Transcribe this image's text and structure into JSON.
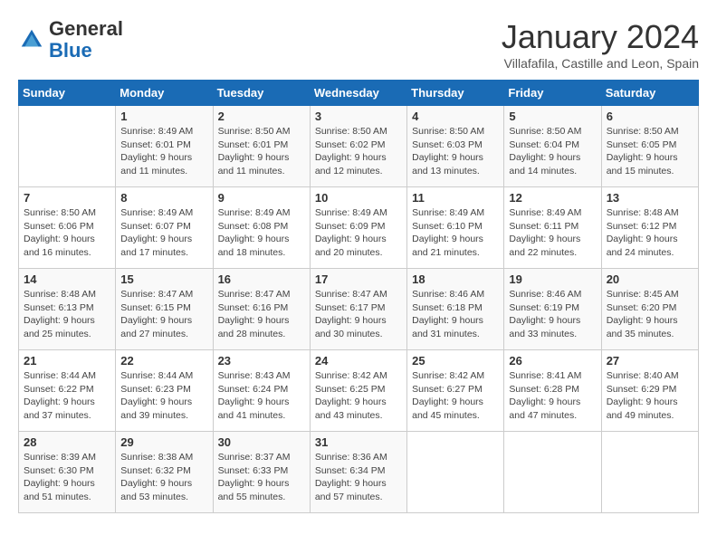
{
  "logo": {
    "general": "General",
    "blue": "Blue"
  },
  "header": {
    "month": "January 2024",
    "location": "Villafafila, Castille and Leon, Spain"
  },
  "weekdays": [
    "Sunday",
    "Monday",
    "Tuesday",
    "Wednesday",
    "Thursday",
    "Friday",
    "Saturday"
  ],
  "rows": [
    [
      {
        "day": "",
        "sunrise": "",
        "sunset": "",
        "daylight": ""
      },
      {
        "day": "1",
        "sunrise": "Sunrise: 8:49 AM",
        "sunset": "Sunset: 6:01 PM",
        "daylight": "Daylight: 9 hours and 11 minutes."
      },
      {
        "day": "2",
        "sunrise": "Sunrise: 8:50 AM",
        "sunset": "Sunset: 6:01 PM",
        "daylight": "Daylight: 9 hours and 11 minutes."
      },
      {
        "day": "3",
        "sunrise": "Sunrise: 8:50 AM",
        "sunset": "Sunset: 6:02 PM",
        "daylight": "Daylight: 9 hours and 12 minutes."
      },
      {
        "day": "4",
        "sunrise": "Sunrise: 8:50 AM",
        "sunset": "Sunset: 6:03 PM",
        "daylight": "Daylight: 9 hours and 13 minutes."
      },
      {
        "day": "5",
        "sunrise": "Sunrise: 8:50 AM",
        "sunset": "Sunset: 6:04 PM",
        "daylight": "Daylight: 9 hours and 14 minutes."
      },
      {
        "day": "6",
        "sunrise": "Sunrise: 8:50 AM",
        "sunset": "Sunset: 6:05 PM",
        "daylight": "Daylight: 9 hours and 15 minutes."
      }
    ],
    [
      {
        "day": "7",
        "sunrise": "Sunrise: 8:50 AM",
        "sunset": "Sunset: 6:06 PM",
        "daylight": "Daylight: 9 hours and 16 minutes."
      },
      {
        "day": "8",
        "sunrise": "Sunrise: 8:49 AM",
        "sunset": "Sunset: 6:07 PM",
        "daylight": "Daylight: 9 hours and 17 minutes."
      },
      {
        "day": "9",
        "sunrise": "Sunrise: 8:49 AM",
        "sunset": "Sunset: 6:08 PM",
        "daylight": "Daylight: 9 hours and 18 minutes."
      },
      {
        "day": "10",
        "sunrise": "Sunrise: 8:49 AM",
        "sunset": "Sunset: 6:09 PM",
        "daylight": "Daylight: 9 hours and 20 minutes."
      },
      {
        "day": "11",
        "sunrise": "Sunrise: 8:49 AM",
        "sunset": "Sunset: 6:10 PM",
        "daylight": "Daylight: 9 hours and 21 minutes."
      },
      {
        "day": "12",
        "sunrise": "Sunrise: 8:49 AM",
        "sunset": "Sunset: 6:11 PM",
        "daylight": "Daylight: 9 hours and 22 minutes."
      },
      {
        "day": "13",
        "sunrise": "Sunrise: 8:48 AM",
        "sunset": "Sunset: 6:12 PM",
        "daylight": "Daylight: 9 hours and 24 minutes."
      }
    ],
    [
      {
        "day": "14",
        "sunrise": "Sunrise: 8:48 AM",
        "sunset": "Sunset: 6:13 PM",
        "daylight": "Daylight: 9 hours and 25 minutes."
      },
      {
        "day": "15",
        "sunrise": "Sunrise: 8:47 AM",
        "sunset": "Sunset: 6:15 PM",
        "daylight": "Daylight: 9 hours and 27 minutes."
      },
      {
        "day": "16",
        "sunrise": "Sunrise: 8:47 AM",
        "sunset": "Sunset: 6:16 PM",
        "daylight": "Daylight: 9 hours and 28 minutes."
      },
      {
        "day": "17",
        "sunrise": "Sunrise: 8:47 AM",
        "sunset": "Sunset: 6:17 PM",
        "daylight": "Daylight: 9 hours and 30 minutes."
      },
      {
        "day": "18",
        "sunrise": "Sunrise: 8:46 AM",
        "sunset": "Sunset: 6:18 PM",
        "daylight": "Daylight: 9 hours and 31 minutes."
      },
      {
        "day": "19",
        "sunrise": "Sunrise: 8:46 AM",
        "sunset": "Sunset: 6:19 PM",
        "daylight": "Daylight: 9 hours and 33 minutes."
      },
      {
        "day": "20",
        "sunrise": "Sunrise: 8:45 AM",
        "sunset": "Sunset: 6:20 PM",
        "daylight": "Daylight: 9 hours and 35 minutes."
      }
    ],
    [
      {
        "day": "21",
        "sunrise": "Sunrise: 8:44 AM",
        "sunset": "Sunset: 6:22 PM",
        "daylight": "Daylight: 9 hours and 37 minutes."
      },
      {
        "day": "22",
        "sunrise": "Sunrise: 8:44 AM",
        "sunset": "Sunset: 6:23 PM",
        "daylight": "Daylight: 9 hours and 39 minutes."
      },
      {
        "day": "23",
        "sunrise": "Sunrise: 8:43 AM",
        "sunset": "Sunset: 6:24 PM",
        "daylight": "Daylight: 9 hours and 41 minutes."
      },
      {
        "day": "24",
        "sunrise": "Sunrise: 8:42 AM",
        "sunset": "Sunset: 6:25 PM",
        "daylight": "Daylight: 9 hours and 43 minutes."
      },
      {
        "day": "25",
        "sunrise": "Sunrise: 8:42 AM",
        "sunset": "Sunset: 6:27 PM",
        "daylight": "Daylight: 9 hours and 45 minutes."
      },
      {
        "day": "26",
        "sunrise": "Sunrise: 8:41 AM",
        "sunset": "Sunset: 6:28 PM",
        "daylight": "Daylight: 9 hours and 47 minutes."
      },
      {
        "day": "27",
        "sunrise": "Sunrise: 8:40 AM",
        "sunset": "Sunset: 6:29 PM",
        "daylight": "Daylight: 9 hours and 49 minutes."
      }
    ],
    [
      {
        "day": "28",
        "sunrise": "Sunrise: 8:39 AM",
        "sunset": "Sunset: 6:30 PM",
        "daylight": "Daylight: 9 hours and 51 minutes."
      },
      {
        "day": "29",
        "sunrise": "Sunrise: 8:38 AM",
        "sunset": "Sunset: 6:32 PM",
        "daylight": "Daylight: 9 hours and 53 minutes."
      },
      {
        "day": "30",
        "sunrise": "Sunrise: 8:37 AM",
        "sunset": "Sunset: 6:33 PM",
        "daylight": "Daylight: 9 hours and 55 minutes."
      },
      {
        "day": "31",
        "sunrise": "Sunrise: 8:36 AM",
        "sunset": "Sunset: 6:34 PM",
        "daylight": "Daylight: 9 hours and 57 minutes."
      },
      {
        "day": "",
        "sunrise": "",
        "sunset": "",
        "daylight": ""
      },
      {
        "day": "",
        "sunrise": "",
        "sunset": "",
        "daylight": ""
      },
      {
        "day": "",
        "sunrise": "",
        "sunset": "",
        "daylight": ""
      }
    ]
  ]
}
